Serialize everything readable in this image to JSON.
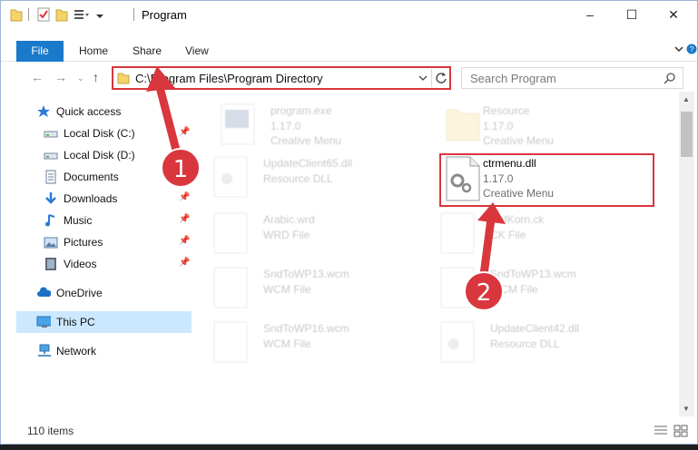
{
  "window": {
    "title": "Program",
    "controls": [
      "–",
      "☐",
      "✕"
    ]
  },
  "ribbon": {
    "file": "File",
    "tabs": [
      "Home",
      "Share",
      "View"
    ]
  },
  "address": {
    "path": "C:\\Program Files\\Program Directory",
    "refresh_icon": "refresh-icon"
  },
  "search": {
    "placeholder": "Search Program"
  },
  "sidebar": {
    "items": [
      {
        "label": "Quick access",
        "icon": "star-icon"
      },
      {
        "label": "Local Disk (C:)",
        "icon": "drive-icon",
        "pinned": true
      },
      {
        "label": "Local Disk (D:)",
        "icon": "drive-icon"
      },
      {
        "label": "Documents",
        "icon": "documents-icon"
      },
      {
        "label": "Downloads",
        "icon": "download-icon",
        "pinned": true
      },
      {
        "label": "Music",
        "icon": "music-icon",
        "pinned": true
      },
      {
        "label": "Pictures",
        "icon": "pictures-icon",
        "pinned": true
      },
      {
        "label": "Videos",
        "icon": "videos-icon",
        "pinned": true
      },
      {
        "label": "OneDrive",
        "icon": "cloud-icon"
      },
      {
        "label": "This PC",
        "icon": "computer-icon",
        "selected": true
      },
      {
        "label": "Network",
        "icon": "network-icon"
      }
    ]
  },
  "files": [
    {
      "name": "program.exe",
      "line1": "1.17.0",
      "line2": "Creative Menu",
      "icon": "exe-icon"
    },
    {
      "name": "Resource",
      "line1": "1.17.0",
      "line2": "Creative Menu",
      "icon": "folder-icon"
    },
    {
      "name": "UpdateClient65.dll",
      "line1": "Resource DLL",
      "line2": "",
      "icon": "dll-icon"
    },
    {
      "name": "ctrmenu.dll",
      "line1": "1.17.0",
      "line2": "Creative Menu",
      "icon": "dll-icon",
      "highlighted": true
    },
    {
      "name": "Arabic.wrd",
      "line1": "WRD File",
      "line2": "",
      "icon": "file-icon"
    },
    {
      "name": "DefKorn.ck",
      "line1": "CK File",
      "line2": "",
      "icon": "file-icon"
    },
    {
      "name": "SndToWP13.wcm",
      "line1": "WCM File",
      "line2": "",
      "icon": "file-icon"
    },
    {
      "name": "SndToWP13.wcm",
      "line1": "WCM File",
      "line2": "",
      "icon": "file-icon"
    },
    {
      "name": "SndToWP16.wcm",
      "line1": "WCM File",
      "line2": "",
      "icon": "file-icon"
    },
    {
      "name": "UpdateClient42.dll",
      "line1": "Resource DLL",
      "line2": "",
      "icon": "dll-icon"
    }
  ],
  "status": {
    "items_count": "110 items"
  },
  "callouts": [
    "1",
    "2"
  ],
  "colors": {
    "accent": "#1979ca",
    "highlight_red": "#d9363e",
    "selected_bg": "#cce8ff"
  }
}
